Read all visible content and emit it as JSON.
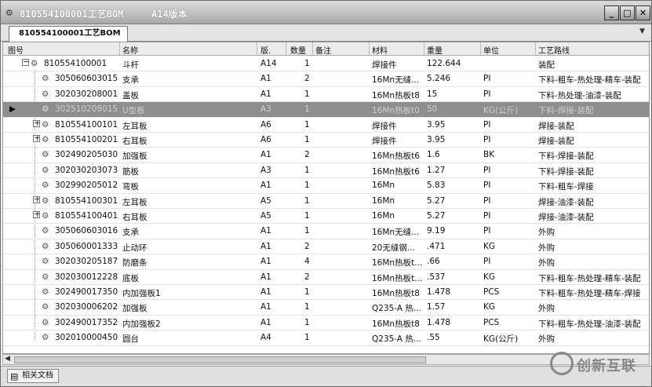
{
  "window": {
    "doc_title": "810554100001工艺BOM",
    "version_title": "A14版本",
    "title_icon": "app-icon",
    "controls": [
      "minimize-icon",
      "maximize-icon",
      "close-icon"
    ]
  },
  "tabs": [
    {
      "label": "810554100001工艺BOM"
    }
  ],
  "table": {
    "columns": [
      "图号",
      "名称",
      "版.",
      "数量",
      "备注",
      "材料",
      "重量",
      "单位",
      "工艺路线"
    ],
    "rows": [
      {
        "code": "810554100001",
        "name": "斗杆",
        "ver": "A14",
        "qty": "1",
        "note": "",
        "material": "焊接件",
        "weight": "122.644",
        "unit": "",
        "route": "装配",
        "level": 0,
        "expander": "-"
      },
      {
        "code": "305060603015",
        "name": "支承",
        "ver": "A1",
        "qty": "2",
        "note": "",
        "material": "16Mn无缝...",
        "weight": "5.246",
        "unit": "PI",
        "route": "下料-粗车-热处理-精车-装配",
        "level": 1,
        "expander": ""
      },
      {
        "code": "302030208001",
        "name": "盖板",
        "ver": "A1",
        "qty": "1",
        "note": "",
        "material": "16Mn热板t8",
        "weight": "15",
        "unit": "PI",
        "route": "下料-热处理-油漆-装配",
        "level": 1,
        "expander": ""
      },
      {
        "code": "302510208015",
        "name": "U型板",
        "ver": "A3",
        "qty": "1",
        "note": "",
        "material": "16Mn热板t0",
        "weight": "50",
        "unit": "KG(公斤)",
        "route": "下料-焊接-装配",
        "level": 1,
        "expander": "",
        "selected": true
      },
      {
        "code": "810554100101",
        "name": "左耳板",
        "ver": "A6",
        "qty": "1",
        "note": "",
        "material": "焊接件",
        "weight": "3.95",
        "unit": "PI",
        "route": "焊接-装配",
        "level": 1,
        "expander": "+"
      },
      {
        "code": "810554100201",
        "name": "右耳板",
        "ver": "A6",
        "qty": "1",
        "note": "",
        "material": "焊接件",
        "weight": "3.95",
        "unit": "PI",
        "route": "焊接-装配",
        "level": 1,
        "expander": "+"
      },
      {
        "code": "302490205030",
        "name": "加强板",
        "ver": "A1",
        "qty": "2",
        "note": "",
        "material": "16Mn热板t6",
        "weight": "1.6",
        "unit": "BK",
        "route": "下料-焊接-装配",
        "level": 1,
        "expander": ""
      },
      {
        "code": "302030203073",
        "name": "筋板",
        "ver": "A3",
        "qty": "1",
        "note": "",
        "material": "16Mn热板t6",
        "weight": "1.27",
        "unit": "PI",
        "route": "下料-焊接-装配",
        "level": 1,
        "expander": ""
      },
      {
        "code": "302990205012",
        "name": "弯板",
        "ver": "A1",
        "qty": "1",
        "note": "",
        "material": "16Mn",
        "weight": "5.83",
        "unit": "PI",
        "route": "下料-粗车-焊接",
        "level": 1,
        "expander": ""
      },
      {
        "code": "810554100301",
        "name": "左耳板",
        "ver": "A5",
        "qty": "1",
        "note": "",
        "material": "16Mn",
        "weight": "5.27",
        "unit": "PI",
        "route": "焊接-油漆-装配",
        "level": 1,
        "expander": "+"
      },
      {
        "code": "810554100401",
        "name": "右耳板",
        "ver": "A5",
        "qty": "1",
        "note": "",
        "material": "16Mn",
        "weight": "5.27",
        "unit": "PI",
        "route": "焊接-油漆-装配",
        "level": 1,
        "expander": "+"
      },
      {
        "code": "305060603016",
        "name": "支承",
        "ver": "A1",
        "qty": "1",
        "note": "",
        "material": "16Mn无缝...",
        "weight": "9.19",
        "unit": "PI",
        "route": "外购",
        "level": 1,
        "expander": ""
      },
      {
        "code": "305060001333",
        "name": "止动环",
        "ver": "A1",
        "qty": "2",
        "note": "",
        "material": "20无缝钢...",
        "weight": ".471",
        "unit": "KG",
        "route": "外购",
        "level": 1,
        "expander": ""
      },
      {
        "code": "302030205187",
        "name": "防磨条",
        "ver": "A1",
        "qty": "4",
        "note": "",
        "material": "16Mn热板t...",
        "weight": ".66",
        "unit": "PI",
        "route": "外购",
        "level": 1,
        "expander": ""
      },
      {
        "code": "302030012228",
        "name": "底板",
        "ver": "A1",
        "qty": "2",
        "note": "",
        "material": "16Mn热板t...",
        "weight": ".537",
        "unit": "KG",
        "route": "下料-粗车-热处理-精车-装配",
        "level": 1,
        "expander": ""
      },
      {
        "code": "302490017350",
        "name": "内加强板1",
        "ver": "A1",
        "qty": "1",
        "note": "",
        "material": "16Mn热板t8",
        "weight": "1.478",
        "unit": "PCS",
        "route": "下料-粗车-热处理-精车-焊接",
        "level": 1,
        "expander": ""
      },
      {
        "code": "302030006202",
        "name": "加强板",
        "ver": "A1",
        "qty": "1",
        "note": "",
        "material": "Q235-A 热...",
        "weight": "1.57",
        "unit": "KG",
        "route": "外购",
        "level": 1,
        "expander": ""
      },
      {
        "code": "302490017352",
        "name": "内加强板2",
        "ver": "A1",
        "qty": "1",
        "note": "",
        "material": "16Mn热板t8",
        "weight": "1.478",
        "unit": "PCS",
        "route": "下料-粗车-热处理-油漆-装配",
        "level": 1,
        "expander": ""
      },
      {
        "code": "302010000450",
        "name": "圆台",
        "ver": "A4",
        "qty": "1",
        "note": "",
        "material": "Q235-A 热...",
        "weight": ".55",
        "unit": "KG(公斤)",
        "route": "外购",
        "level": 1,
        "expander": ""
      }
    ]
  },
  "bottom": {
    "doc_tab": "相关文档"
  },
  "logo": {
    "text": "创新互联"
  }
}
